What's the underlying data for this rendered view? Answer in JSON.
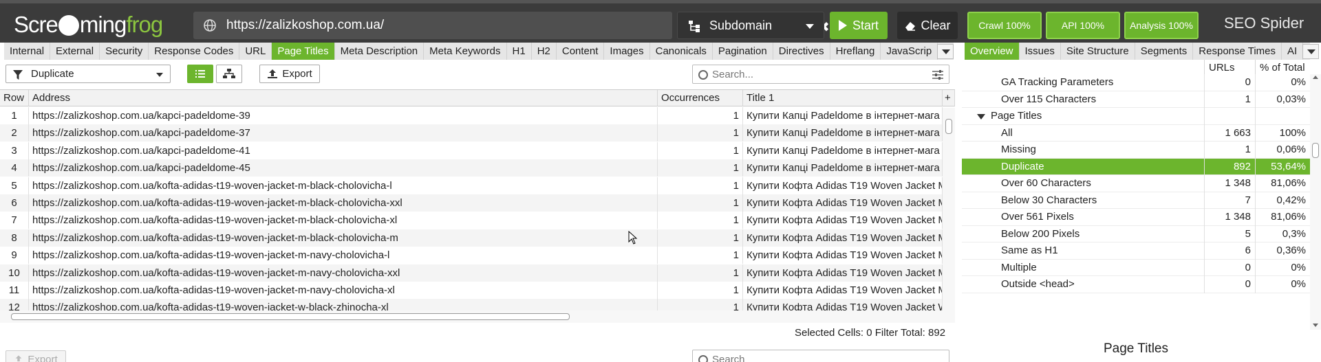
{
  "app": {
    "url": "https://zalizkoshop.com.ua/",
    "mode": "Subdomain",
    "start_label": "Start",
    "clear_label": "Clear",
    "crawl_label": "Crawl 100%",
    "api_label": "API 100%",
    "analysis_label": "Analysis 100%",
    "product_title": "SEO Spider",
    "logo_left": "Scre",
    "logo_mid": "ming",
    "logo_right": "frog"
  },
  "colors": {
    "accent": "#6cb52d",
    "topbar": "#3b3b3b"
  },
  "left_tabs": [
    "Internal",
    "External",
    "Security",
    "Response Codes",
    "URL",
    "Page Titles",
    "Meta Description",
    "Meta Keywords",
    "H1",
    "H2",
    "Content",
    "Images",
    "Canonicals",
    "Pagination",
    "Directives",
    "Hreflang",
    "JavaScrip"
  ],
  "left_tabs_active": "Page Titles",
  "right_tabs": [
    "Overview",
    "Issues",
    "Site Structure",
    "Segments",
    "Response Times",
    "AI"
  ],
  "right_tabs_active": "Overview",
  "toolbar": {
    "filter_value": "Duplicate",
    "export_label": "Export",
    "search_placeholder": "Search..."
  },
  "table": {
    "columns": [
      "Row",
      "Address",
      "Occurrences",
      "Title 1"
    ],
    "rows": [
      {
        "row": "1",
        "address": "https://zalizkoshop.com.ua/kapci-padeldome-39",
        "occ": "1",
        "title": "Купити Капці Padeldome в інтернет-мага"
      },
      {
        "row": "2",
        "address": "https://zalizkoshop.com.ua/kapci-padeldome-37",
        "occ": "1",
        "title": "Купити Капці Padeldome в інтернет-мага"
      },
      {
        "row": "3",
        "address": "https://zalizkoshop.com.ua/kapci-padeldome-41",
        "occ": "1",
        "title": "Купити Капці Padeldome в інтернет-мага"
      },
      {
        "row": "4",
        "address": "https://zalizkoshop.com.ua/kapci-padeldome-45",
        "occ": "1",
        "title": "Купити Капці Padeldome в інтернет-мага"
      },
      {
        "row": "5",
        "address": "https://zalizkoshop.com.ua/kofta-adidas-t19-woven-jacket-m-black-cholovicha-l",
        "occ": "1",
        "title": "Купити Кофта Adidas T19 Woven Jacket M"
      },
      {
        "row": "6",
        "address": "https://zalizkoshop.com.ua/kofta-adidas-t19-woven-jacket-m-black-cholovicha-xxl",
        "occ": "1",
        "title": "Купити Кофта Adidas T19 Woven Jacket M"
      },
      {
        "row": "7",
        "address": "https://zalizkoshop.com.ua/kofta-adidas-t19-woven-jacket-m-black-cholovicha-xl",
        "occ": "1",
        "title": "Купити Кофта Adidas T19 Woven Jacket M"
      },
      {
        "row": "8",
        "address": "https://zalizkoshop.com.ua/kofta-adidas-t19-woven-jacket-m-black-cholovicha-m",
        "occ": "1",
        "title": "Купити Кофта Adidas T19 Woven Jacket M"
      },
      {
        "row": "9",
        "address": "https://zalizkoshop.com.ua/kofta-adidas-t19-woven-jacket-m-navy-cholovicha-l",
        "occ": "1",
        "title": "Купити Кофта Adidas T19 Woven Jacket M"
      },
      {
        "row": "10",
        "address": "https://zalizkoshop.com.ua/kofta-adidas-t19-woven-jacket-m-navy-cholovicha-xxl",
        "occ": "1",
        "title": "Купити Кофта Adidas T19 Woven Jacket M"
      },
      {
        "row": "11",
        "address": "https://zalizkoshop.com.ua/kofta-adidas-t19-woven-jacket-m-navy-cholovicha-xl",
        "occ": "1",
        "title": "Купити Кофта Adidas T19 Woven Jacket M"
      },
      {
        "row": "12",
        "address": "https://zalizkoshop.com.ua/kofta-adidas-t19-woven-jacket-w-black-zhinocha-xl",
        "occ": "1",
        "title": "Купити Кофта Adidas T19 Woven Jacket W"
      }
    ]
  },
  "status": {
    "selected_label": "Selected Cells:",
    "selected_value": "0",
    "filter_label": "Filter Total:",
    "filter_value": "892"
  },
  "bottom": {
    "export_label": "Export",
    "search_placeholder": "Search"
  },
  "overview": {
    "col_urls": "URLs",
    "col_pct": "% of Total",
    "rows": [
      {
        "label": "GA Tracking Parameters",
        "urls": "0",
        "pct": "0%",
        "level": 2
      },
      {
        "label": "Over 115 Characters",
        "urls": "1",
        "pct": "0,03%",
        "level": 2
      },
      {
        "label": "Page Titles",
        "urls": "",
        "pct": "",
        "level": 1,
        "expanded": true
      },
      {
        "label": "All",
        "urls": "1 663",
        "pct": "100%",
        "level": 2
      },
      {
        "label": "Missing",
        "urls": "1",
        "pct": "0,06%",
        "level": 2
      },
      {
        "label": "Duplicate",
        "urls": "892",
        "pct": "53,64%",
        "level": 2,
        "selected": true
      },
      {
        "label": "Over 60 Characters",
        "urls": "1 348",
        "pct": "81,06%",
        "level": 2
      },
      {
        "label": "Below 30 Characters",
        "urls": "7",
        "pct": "0,42%",
        "level": 2
      },
      {
        "label": "Over 561 Pixels",
        "urls": "1 348",
        "pct": "81,06%",
        "level": 2
      },
      {
        "label": "Below 200 Pixels",
        "urls": "5",
        "pct": "0,3%",
        "level": 2
      },
      {
        "label": "Same as H1",
        "urls": "6",
        "pct": "0,36%",
        "level": 2
      },
      {
        "label": "Multiple",
        "urls": "0",
        "pct": "0%",
        "level": 2
      },
      {
        "label": "Outside <head>",
        "urls": "0",
        "pct": "0%",
        "level": 2
      }
    ],
    "panel_title": "Page Titles"
  }
}
